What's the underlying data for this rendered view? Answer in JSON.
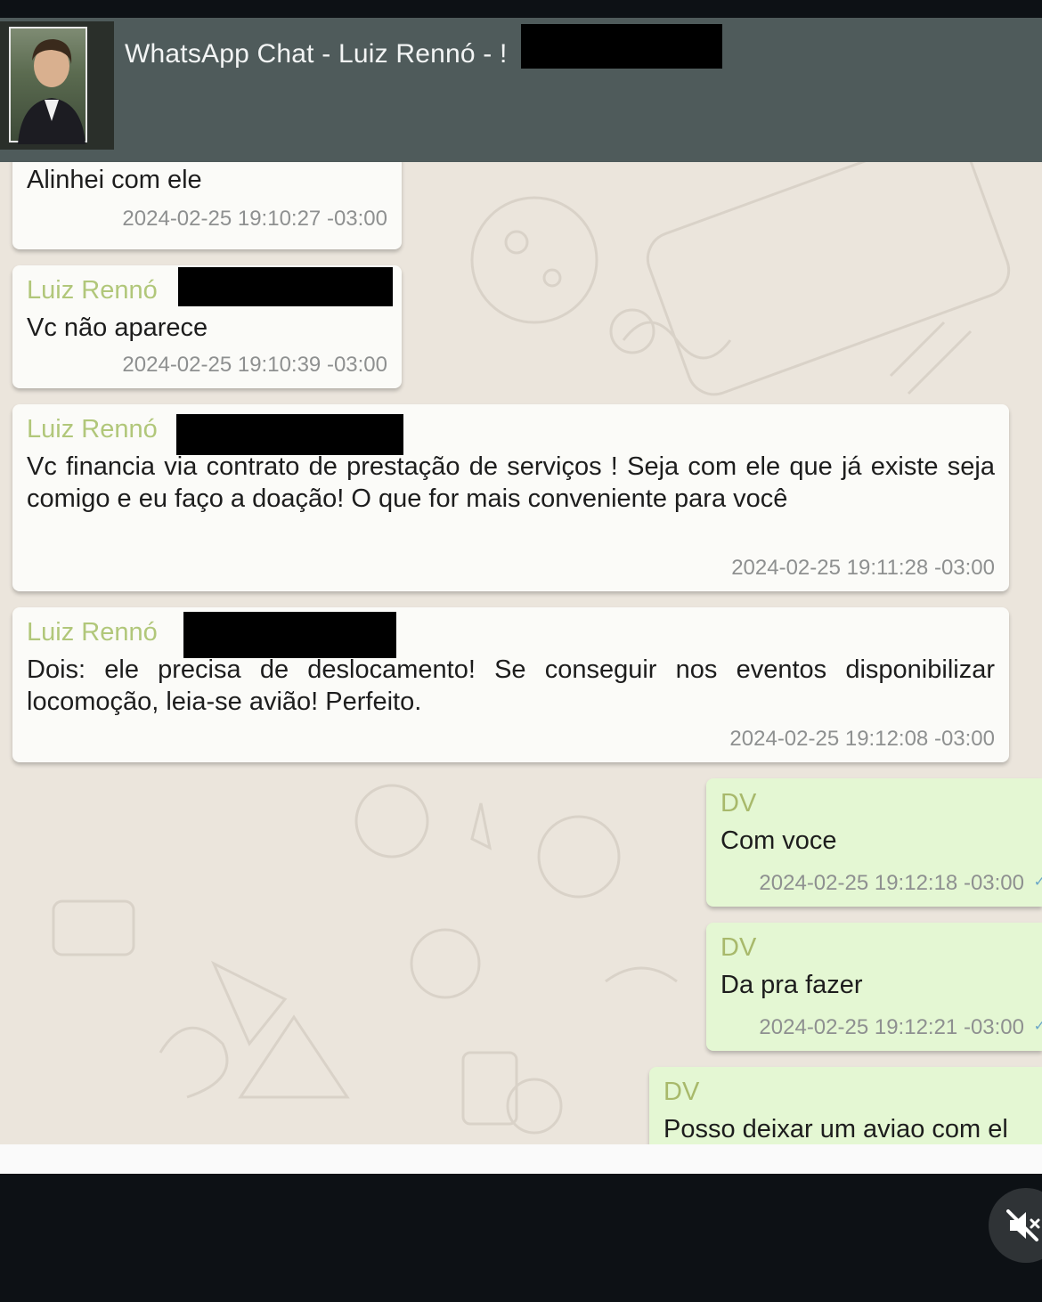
{
  "header": {
    "title": "WhatsApp Chat - Luiz Rennó - ",
    "title_suffix_visible": "!"
  },
  "messages": [
    {
      "sender": "",
      "text": "Alinhei com ele",
      "timestamp": "2024-02-25 19:10:27 -03:00"
    },
    {
      "sender": "Luiz Rennó",
      "text": "Vc não aparece",
      "timestamp": "2024-02-25 19:10:39 -03:00"
    },
    {
      "sender": "Luiz Rennó",
      "text": "Vc financia via contrato de prestação de serviços ! Seja com ele que já existe seja comigo e eu faço a doação! O que for mais conveniente para você",
      "timestamp": "2024-02-25 19:11:28 -03:00"
    },
    {
      "sender": "Luiz Rennó",
      "text": "Dois: ele precisa de deslocamento! Se conseguir nos eventos disponibilizar locomoção, leia-se avião! Perfeito.",
      "timestamp": "2024-02-25 19:12:08 -03:00"
    },
    {
      "sender": "DV",
      "text": "Com voce",
      "timestamp": "2024-02-25 19:12:18 -03:00"
    },
    {
      "sender": "DV",
      "text": "Da pra fazer",
      "timestamp": "2024-02-25 19:12:21 -03:00"
    },
    {
      "sender": "DV",
      "text": "Posso deixar um aviao com el",
      "timestamp": ""
    }
  ],
  "colors": {
    "header_bg": "#4f5b5b",
    "chat_bg": "#ebe5dc",
    "incoming_bubble": "#fbfbf8",
    "outgoing_bubble": "#e4f7d3",
    "sender_name": "#b1c77a",
    "timestamp": "#8e9090"
  },
  "icons": {
    "mute": "speaker-muted-icon",
    "read_receipt": "checkmark-icon"
  }
}
